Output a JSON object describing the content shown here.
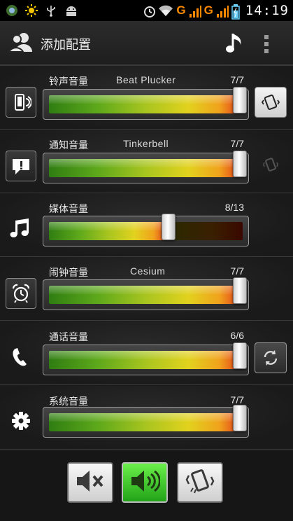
{
  "status_bar": {
    "time": "14:19",
    "network_letter_1": "G",
    "network_letter_2": "G",
    "icons": [
      "app-icon",
      "weather-sun-icon",
      "usb-icon",
      "android-icon",
      "alarm-icon",
      "wifi-icon",
      "signal-icon",
      "battery-icon"
    ]
  },
  "header": {
    "title": "添加配置",
    "left_icon": "profile-users-icon",
    "right_icons": [
      "music-note-icon",
      "overflow-menu-icon"
    ]
  },
  "volumes": [
    {
      "label": "铃声音量",
      "ringtone": "Beat Plucker",
      "level": "7/7",
      "fraction": 1.0,
      "icon": "phone-ring-icon",
      "side": "vibrate-button"
    },
    {
      "label": "通知音量",
      "ringtone": "Tinkerbell",
      "level": "7/7",
      "fraction": 1.0,
      "icon": "notification-icon",
      "side": "vibrate-indicator"
    },
    {
      "label": "媒体音量",
      "ringtone": "",
      "level": "8/13",
      "fraction": 0.615,
      "icon": "music-icon",
      "side": ""
    },
    {
      "label": "闹钟音量",
      "ringtone": "Cesium",
      "level": "7/7",
      "fraction": 1.0,
      "icon": "alarm-clock-icon",
      "side": ""
    },
    {
      "label": "通话音量",
      "ringtone": "",
      "level": "6/6",
      "fraction": 1.0,
      "icon": "call-icon",
      "side": "sync-button"
    },
    {
      "label": "系统音量",
      "ringtone": "",
      "level": "7/7",
      "fraction": 1.0,
      "icon": "settings-gear-icon",
      "side": ""
    }
  ],
  "modes": {
    "items": [
      "mute-icon",
      "sound-on-icon",
      "vibrate-icon"
    ],
    "active": "sound-on-icon"
  },
  "colors": {
    "accent_green": "#3fd42a",
    "meter_low": "#2f7d12",
    "meter_high": "#e0301a"
  }
}
